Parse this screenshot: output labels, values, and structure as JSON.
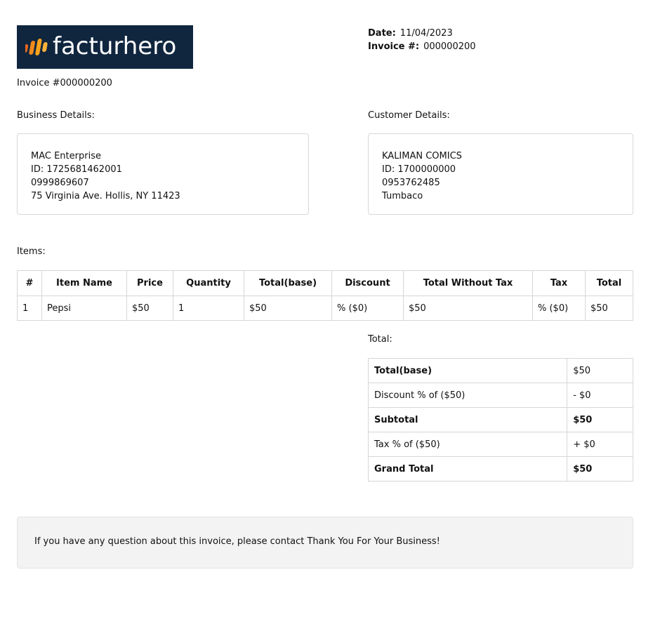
{
  "brand": {
    "name": "facturhero",
    "colors": {
      "logo_bg": "#10263f",
      "mark_light": "#f7a21b",
      "mark_dark": "#e8651e"
    }
  },
  "meta": {
    "date_label": "Date:",
    "date_value": "11/04/2023",
    "invoice_label": "Invoice #:",
    "invoice_value": "000000200"
  },
  "invoice_title": "Invoice #000000200",
  "business": {
    "label": "Business Details:",
    "lines": [
      "MAC Enterprise",
      "ID: 1725681462001",
      "0999869607",
      "75 Virginia Ave. Hollis, NY 11423"
    ]
  },
  "customer": {
    "label": "Customer Details:",
    "lines": [
      "KALIMAN COMICS",
      "ID: 1700000000",
      "0953762485",
      "Tumbaco"
    ]
  },
  "items": {
    "label": "Items:",
    "headers": [
      "#",
      "Item Name",
      "Price",
      "Quantity",
      "Total(base)",
      "Discount",
      "Total Without Tax",
      "Tax",
      "Total"
    ],
    "rows": [
      [
        "1",
        "Pepsi",
        "$50",
        "1",
        "$50",
        "% ($0)",
        "$50",
        "% ($0)",
        "$50"
      ]
    ]
  },
  "totals": {
    "label": "Total:",
    "rows": [
      {
        "label": "Total(base)",
        "value": "$50",
        "bold_label": true,
        "bold_value": false
      },
      {
        "label": "Discount % of ($50)",
        "value": "- $0",
        "bold_label": false,
        "bold_value": false
      },
      {
        "label": "Subtotal",
        "value": "$50",
        "bold_label": true,
        "bold_value": true
      },
      {
        "label": "Tax % of ($50)",
        "value": "+ $0",
        "bold_label": false,
        "bold_value": false
      },
      {
        "label": "Grand Total",
        "value": "$50",
        "bold_label": true,
        "bold_value": true
      }
    ]
  },
  "footer": {
    "text": "If you have any question about this invoice, please contact Thank You For Your Business!"
  }
}
